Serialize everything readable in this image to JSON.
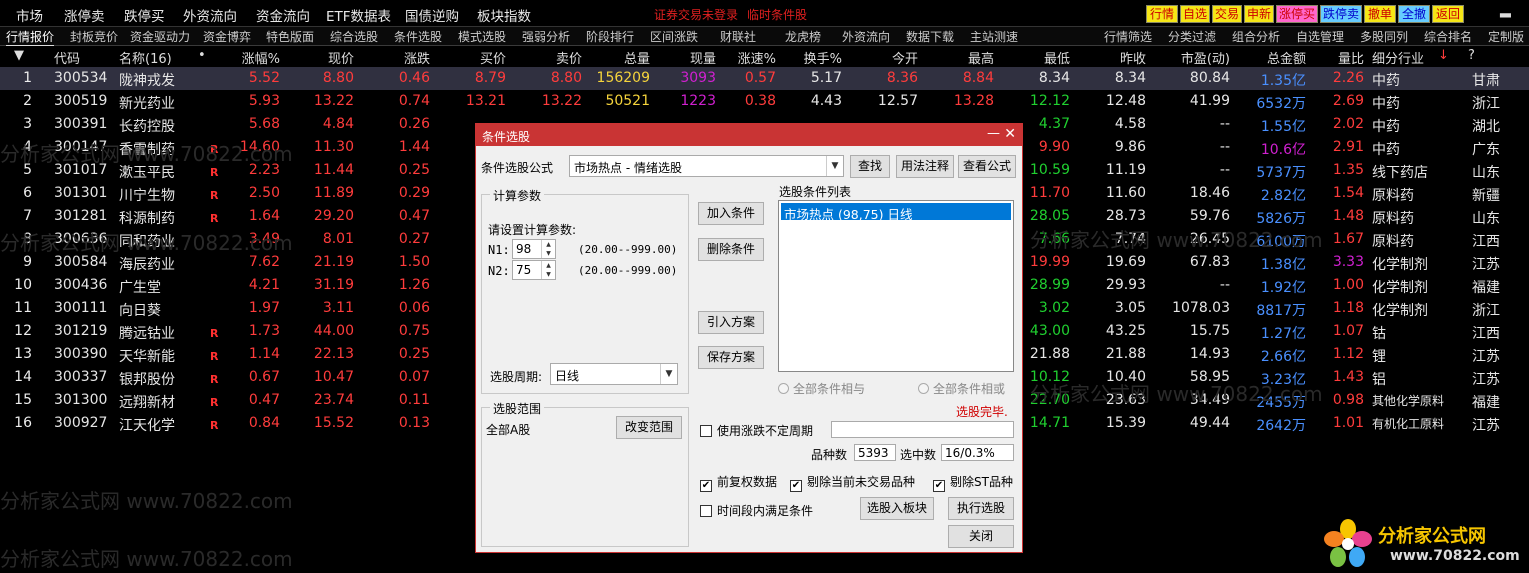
{
  "menu": {
    "items": [
      "市场",
      "涨停卖",
      "跌停买",
      "外资流向",
      "资金流向",
      "ETF数据表",
      "国债逆购",
      "板块指数"
    ],
    "warning": [
      "证券交易未登录",
      "临时条件股"
    ],
    "right_buttons": [
      {
        "label": "行情",
        "bg": "#f5e616",
        "fg": "#cc0000"
      },
      {
        "label": "自选",
        "bg": "#f5e616",
        "fg": "#cc0000"
      },
      {
        "label": "交易",
        "bg": "#f5e616",
        "fg": "#cc0000"
      },
      {
        "label": "申新",
        "bg": "#f5e616",
        "fg": "#cc0000"
      },
      {
        "label": "涨停买",
        "bg": "#ff66cc",
        "fg": "#cc0000"
      },
      {
        "label": "跌停卖",
        "bg": "#66ccff",
        "fg": "#0000cc"
      },
      {
        "label": "撤单",
        "bg": "#f5e616",
        "fg": "#cc0000"
      },
      {
        "label": "全撤",
        "bg": "#66ccff",
        "fg": "#0000cc"
      },
      {
        "label": "返回",
        "bg": "#f5e616",
        "fg": "#cc0000"
      }
    ],
    "minimize": "▂"
  },
  "tabs_left": [
    "行情报价",
    "封板竞价",
    "资金驱动力",
    "资金博弈",
    "特色版面",
    "综合选股",
    "条件选股",
    "模式选股",
    "强弱分析",
    "阶段排行",
    "区间涨跌",
    "财联社",
    "龙虎榜",
    "外资流向",
    "数据下载",
    "主站测速"
  ],
  "tabs_right": [
    "行情筛选",
    "分类过滤",
    "组合分析",
    "自选管理",
    "多股同列",
    "综合排名",
    "定制版"
  ],
  "table": {
    "headers": [
      "代码",
      "名称(16)",
      "•",
      "涨幅%",
      "现价",
      "涨跌",
      "买价",
      "卖价",
      "总量",
      "现量",
      "涨速%",
      "换手%",
      "今开",
      "最高",
      "最低",
      "昨收",
      "市盈(动)",
      "总金额",
      "量比",
      "细分行业",
      "?"
    ],
    "sort_indicator": "▼",
    "sort_arrow": "↓",
    "rows": [
      {
        "idx": "1",
        "code": "300534",
        "name": "陇神戎发",
        "r": "",
        "chg": "5.52",
        "price": "8.80",
        "diff": "0.46",
        "bid": "8.79",
        "ask": "8.80",
        "vol": "156209",
        "cur": "3093",
        "speed": "0.57",
        "turn": "5.17",
        "open": "8.36",
        "high": "8.84",
        "low": "8.34",
        "prev": "8.34",
        "pe": "80.84",
        "amount": "1.35亿",
        "ratio": "2.26",
        "industry": "中药",
        "region": "甘肃",
        "low_c": "white",
        "open_c": "red",
        "high_c": "red"
      },
      {
        "idx": "2",
        "code": "300519",
        "name": "新光药业",
        "r": "",
        "chg": "5.93",
        "price": "13.22",
        "diff": "0.74",
        "bid": "13.21",
        "ask": "13.22",
        "vol": "50521",
        "cur": "1223",
        "speed": "0.38",
        "turn": "4.43",
        "open": "12.57",
        "high": "13.28",
        "low": "12.12",
        "prev": "12.48",
        "pe": "41.99",
        "amount": "6532万",
        "ratio": "2.69",
        "industry": "中药",
        "region": "浙江",
        "low_c": "green",
        "open_c": "white",
        "high_c": "red"
      },
      {
        "idx": "3",
        "code": "300391",
        "name": "长药控股",
        "r": "",
        "chg": "5.68",
        "price": "4.84",
        "diff": "0.26",
        "bid": "",
        "ask": "",
        "vol": "",
        "cur": "",
        "speed": "",
        "turn": "",
        "open": "",
        "high": "",
        "low": "4.37",
        "prev": "4.58",
        "pe": "--",
        "amount": "1.55亿",
        "ratio": "2.02",
        "industry": "中药",
        "region": "湖北",
        "low_c": "green",
        "open_c": "red",
        "high_c": "red"
      },
      {
        "idx": "4",
        "code": "300147",
        "name": "香雪制药",
        "r": "R",
        "chg": "14.60",
        "price": "11.30",
        "diff": "1.44",
        "bid": "",
        "ask": "",
        "vol": "",
        "cur": "",
        "speed": "",
        "turn": "",
        "open": "",
        "high": "",
        "low": "9.90",
        "prev": "9.86",
        "pe": "--",
        "amount": "10.6亿",
        "ratio": "2.91",
        "industry": "中药",
        "region": "广东",
        "low_c": "red",
        "open_c": "red",
        "high_c": "red"
      },
      {
        "idx": "5",
        "code": "301017",
        "name": "漱玉平民",
        "r": "R",
        "chg": "2.23",
        "price": "11.44",
        "diff": "0.25",
        "bid": "",
        "ask": "",
        "vol": "",
        "cur": "",
        "speed": "",
        "turn": "",
        "open": "",
        "high": "",
        "low": "10.59",
        "prev": "11.19",
        "pe": "--",
        "amount": "5737万",
        "ratio": "1.35",
        "industry": "线下药店",
        "region": "山东",
        "low_c": "green",
        "open_c": "red",
        "high_c": "red"
      },
      {
        "idx": "6",
        "code": "301301",
        "name": "川宁生物",
        "r": "R",
        "chg": "2.50",
        "price": "11.89",
        "diff": "0.29",
        "bid": "",
        "ask": "",
        "vol": "",
        "cur": "",
        "speed": "",
        "turn": "",
        "open": "",
        "high": "",
        "low": "11.70",
        "prev": "11.60",
        "pe": "18.46",
        "amount": "2.82亿",
        "ratio": "1.54",
        "industry": "原料药",
        "region": "新疆",
        "low_c": "red",
        "open_c": "red",
        "high_c": "red"
      },
      {
        "idx": "7",
        "code": "301281",
        "name": "科源制药",
        "r": "R",
        "chg": "1.64",
        "price": "29.20",
        "diff": "0.47",
        "bid": "",
        "ask": "",
        "vol": "",
        "cur": "",
        "speed": "",
        "turn": "",
        "open": "",
        "high": "",
        "low": "28.05",
        "prev": "28.73",
        "pe": "59.76",
        "amount": "5826万",
        "ratio": "1.48",
        "industry": "原料药",
        "region": "山东",
        "low_c": "green",
        "open_c": "red",
        "high_c": "red"
      },
      {
        "idx": "8",
        "code": "300636",
        "name": "同和药业",
        "r": "",
        "chg": "3.49",
        "price": "8.01",
        "diff": "0.27",
        "bid": "",
        "ask": "",
        "vol": "",
        "cur": "",
        "speed": "",
        "turn": "",
        "open": "",
        "high": "",
        "low": "7.66",
        "prev": "7.74",
        "pe": "26.45",
        "amount": "6100万",
        "ratio": "1.67",
        "industry": "原料药",
        "region": "江西",
        "low_c": "green",
        "open_c": "red",
        "high_c": "red"
      },
      {
        "idx": "9",
        "code": "300584",
        "name": "海辰药业",
        "r": "",
        "chg": "7.62",
        "price": "21.19",
        "diff": "1.50",
        "bid": "2",
        "ask": "",
        "vol": "",
        "cur": "",
        "speed": "",
        "turn": "",
        "open": "",
        "high": "",
        "low": "19.99",
        "prev": "19.69",
        "pe": "67.83",
        "amount": "1.38亿",
        "ratio": "3.33",
        "industry": "化学制剂",
        "region": "江苏",
        "low_c": "red",
        "open_c": "red",
        "high_c": "red"
      },
      {
        "idx": "10",
        "code": "300436",
        "name": "广生堂",
        "r": "",
        "chg": "4.21",
        "price": "31.19",
        "diff": "1.26",
        "bid": "3",
        "ask": "",
        "vol": "",
        "cur": "",
        "speed": "",
        "turn": "",
        "open": "",
        "high": "",
        "low": "28.99",
        "prev": "29.93",
        "pe": "--",
        "amount": "1.92亿",
        "ratio": "1.00",
        "industry": "化学制剂",
        "region": "福建",
        "low_c": "green",
        "open_c": "red",
        "high_c": "red"
      },
      {
        "idx": "11",
        "code": "300111",
        "name": "向日葵",
        "r": "",
        "chg": "1.97",
        "price": "3.11",
        "diff": "0.06",
        "bid": "",
        "ask": "",
        "vol": "",
        "cur": "",
        "speed": "",
        "turn": "",
        "open": "",
        "high": "",
        "low": "3.02",
        "prev": "3.05",
        "pe": "1078.03",
        "amount": "8817万",
        "ratio": "1.18",
        "industry": "化学制剂",
        "region": "浙江",
        "low_c": "green",
        "open_c": "red",
        "high_c": "red"
      },
      {
        "idx": "12",
        "code": "301219",
        "name": "腾远钴业",
        "r": "R",
        "chg": "1.73",
        "price": "44.00",
        "diff": "0.75",
        "bid": "4",
        "ask": "",
        "vol": "",
        "cur": "",
        "speed": "",
        "turn": "",
        "open": "",
        "high": "",
        "low": "43.00",
        "prev": "43.25",
        "pe": "15.75",
        "amount": "1.27亿",
        "ratio": "1.07",
        "industry": "钴",
        "region": "江西",
        "low_c": "green",
        "open_c": "red",
        "high_c": "red"
      },
      {
        "idx": "13",
        "code": "300390",
        "name": "天华新能",
        "r": "R",
        "chg": "1.14",
        "price": "22.13",
        "diff": "0.25",
        "bid": "2",
        "ask": "",
        "vol": "",
        "cur": "",
        "speed": "",
        "turn": "",
        "open": "",
        "high": "",
        "low": "21.88",
        "prev": "21.88",
        "pe": "14.93",
        "amount": "2.66亿",
        "ratio": "1.12",
        "industry": "锂",
        "region": "江苏",
        "low_c": "white",
        "open_c": "red",
        "high_c": "red"
      },
      {
        "idx": "14",
        "code": "300337",
        "name": "银邦股份",
        "r": "R",
        "chg": "0.67",
        "price": "10.47",
        "diff": "0.07",
        "bid": "1",
        "ask": "",
        "vol": "",
        "cur": "",
        "speed": "",
        "turn": "",
        "open": "",
        "high": "",
        "low": "10.12",
        "prev": "10.40",
        "pe": "58.95",
        "amount": "3.23亿",
        "ratio": "1.43",
        "industry": "铝",
        "region": "江苏",
        "low_c": "green",
        "open_c": "red",
        "high_c": "red"
      },
      {
        "idx": "15",
        "code": "301300",
        "name": "远翔新材",
        "r": "R",
        "chg": "0.47",
        "price": "23.74",
        "diff": "0.11",
        "bid": "2",
        "ask": "",
        "vol": "",
        "cur": "",
        "speed": "",
        "turn": "",
        "open": "",
        "high": "",
        "low": "22.70",
        "prev": "23.63",
        "pe": "34.49",
        "amount": "2455万",
        "ratio": "0.98",
        "industry": "其他化学原料",
        "region": "福建",
        "low_c": "green",
        "open_c": "red",
        "high_c": "red"
      },
      {
        "idx": "16",
        "code": "300927",
        "name": "江天化学",
        "r": "R",
        "chg": "0.84",
        "price": "15.52",
        "diff": "0.13",
        "bid": "",
        "ask": "",
        "vol": "",
        "cur": "",
        "speed": "",
        "turn": "",
        "open": "",
        "high": "",
        "low": "14.71",
        "prev": "15.39",
        "pe": "49.44",
        "amount": "2642万",
        "ratio": "1.01",
        "industry": "有机化工原料",
        "region": "江苏",
        "low_c": "green",
        "open_c": "red",
        "high_c": "red"
      }
    ]
  },
  "watermark": "分析家公式网 www.70822.com",
  "dialog": {
    "title": "条件选股",
    "minimize": "—",
    "close": "✕",
    "formula_label": "条件选股公式",
    "formula_value": "市场热点 - 情绪选股",
    "btn_find": "查找",
    "btn_usage": "用法注释",
    "btn_view": "查看公式",
    "params_group": "计算参数",
    "params_prompt": "请设置计算参数:",
    "n1_label": "N1:",
    "n1_value": "98",
    "n1_range": "(20.00--999.00)",
    "n2_label": "N2:",
    "n2_value": "75",
    "n2_range": "(20.00--999.00)",
    "period_label": "选股周期:",
    "period_value": "日线",
    "btn_add": "加入条件",
    "btn_delete": "删除条件",
    "btn_import": "引入方案",
    "btn_save": "保存方案",
    "list_label": "选股条件列表",
    "list_item": "市场热点 (98,75) 日线",
    "radio_and": "全部条件相与",
    "radio_or": "全部条件相或",
    "status": "选股完毕.",
    "scope_group": "选股范围",
    "scope_value": "全部A股",
    "btn_scope": "改变范围",
    "chk_uncertain": "使用涨跌不定周期",
    "count_label": "品种数",
    "count_value": "5393",
    "hit_label": "选中数",
    "hit_value": "16/0.3%",
    "chk_fq": "前复权数据",
    "chk_notrade": "剔除当前未交易品种",
    "chk_st": "剔除ST品种",
    "chk_period": "时间段内满足条件",
    "btn_toblock": "选股入板块",
    "btn_run": "执行选股",
    "btn_close": "关闭",
    "check_mark": "✔"
  },
  "logo": {
    "name": "分析家公式网",
    "url": "www.70822.com"
  }
}
